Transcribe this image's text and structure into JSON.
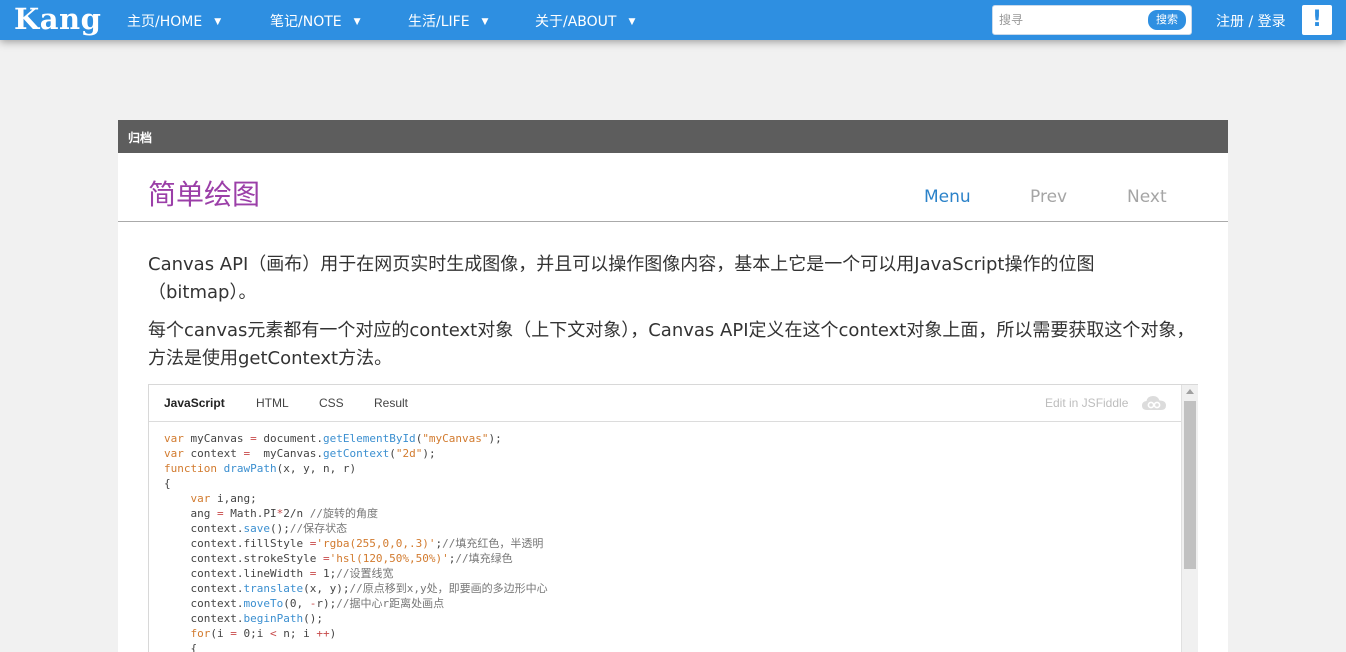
{
  "navbar": {
    "brand": "Kang",
    "items": [
      {
        "label": "主页/HOME"
      },
      {
        "label": "笔记/NOTE"
      },
      {
        "label": "生活/LIFE"
      },
      {
        "label": "关于/ABOUT"
      }
    ],
    "caret": "▼",
    "search": {
      "placeholder": "搜寻",
      "button": "搜索"
    },
    "auth": "注册 / 登录",
    "alert": "!",
    "color": "#2e8fe1"
  },
  "panel": {
    "header": "归档",
    "title": "简单绘图",
    "nav": {
      "menu": "Menu",
      "prev": "Prev",
      "next": "Next"
    },
    "paragraphs": [
      "Canvas API（画布）用于在网页实时生成图像，并且可以操作图像内容，基本上它是一个可以用JavaScript操作的位图（bitmap）。",
      "每个canvas元素都有一个对应的context对象（上下文对象），Canvas API定义在这个context对象上面，所以需要获取这个对象，方法是使用getContext方法。"
    ],
    "title_color": "#9b3fa8"
  },
  "embed": {
    "tabs": [
      {
        "label": "JavaScript"
      },
      {
        "label": "HTML"
      },
      {
        "label": "CSS"
      },
      {
        "label": "Result"
      }
    ],
    "edit_link": "Edit in JSFiddle",
    "cloud_icon": "cloud-icon",
    "code_lines": [
      "var myCanvas = document.getElementById(\"myCanvas\");",
      "var context =  myCanvas.getContext(\"2d\");",
      "function drawPath(x, y, n, r)",
      "{",
      "    var i,ang;",
      "    ang = Math.PI*2/n //旋转的角度",
      "    context.save();//保存状态",
      "    context.fillStyle ='rgba(255,0,0,.3)';//填充红色，半透明",
      "    context.strokeStyle ='hsl(120,50%,50%)';//填充绿色",
      "    context.lineWidth = 1;//设置线宽",
      "    context.translate(x, y);//原点移到x,y处，即要画的多边形中心",
      "    context.moveTo(0, -r);//据中心r距离处画点",
      "    context.beginPath();",
      "    for(i = 0;i < n; i ++)",
      "    {"
    ]
  }
}
